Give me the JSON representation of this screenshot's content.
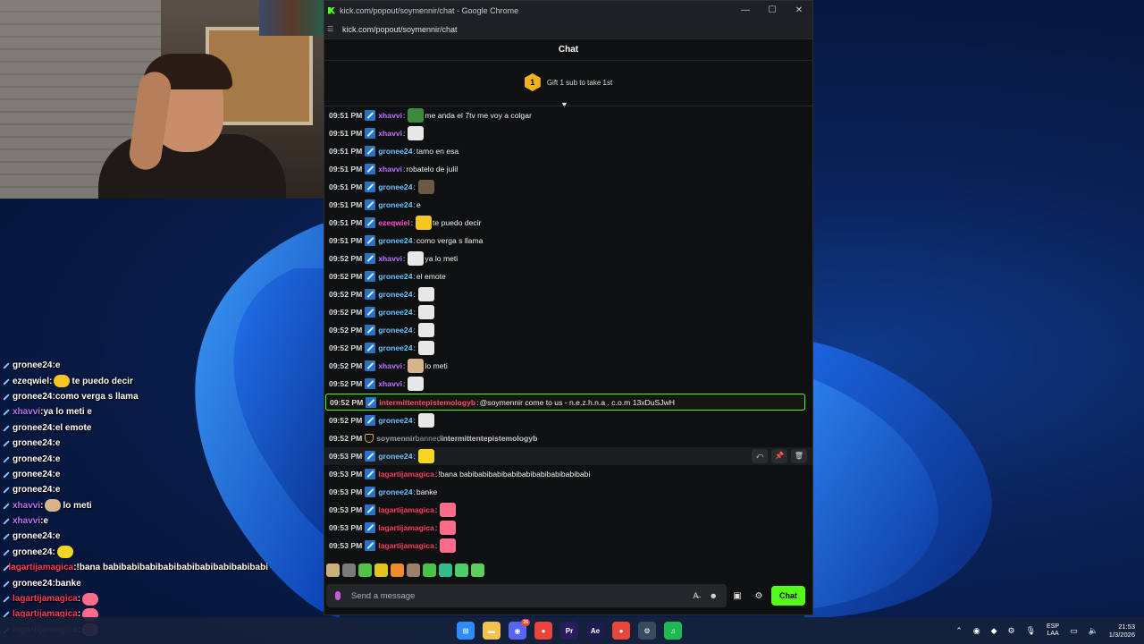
{
  "window": {
    "title": "kick.com/popout/soymennir/chat - Google Chrome",
    "url": "kick.com/popout/soymennir/chat",
    "minimize": "—",
    "maximize": "☐",
    "close": "✕"
  },
  "chat": {
    "header": "Chat",
    "gift_count": "1",
    "gift_text": "Gift 1 sub to take 1st",
    "messages": [
      {
        "ts": "09:51 PM",
        "user": "xhavvi",
        "color": "#b872ff",
        "text": "me anda el 7tv me voy a colgar",
        "emote": "#3d8a3d"
      },
      {
        "ts": "09:51 PM",
        "user": "xhavvi",
        "color": "#b872ff",
        "text": "",
        "emote": "#e8e8e8"
      },
      {
        "ts": "09:51 PM",
        "user": "gronee24",
        "color": "#6ec3ff",
        "text": "tamo en esa",
        "emote": ""
      },
      {
        "ts": "09:51 PM",
        "user": "xhavvi",
        "color": "#b872ff",
        "text": "robatelo de julil",
        "emote": ""
      },
      {
        "ts": "09:51 PM",
        "user": "gronee24",
        "color": "#6ec3ff",
        "text": "",
        "emote": "#6a5a44"
      },
      {
        "ts": "09:51 PM",
        "user": "gronee24",
        "color": "#6ec3ff",
        "text": "e",
        "emote": ""
      },
      {
        "ts": "09:51 PM",
        "user": "ezeqwiel",
        "color": "#ff4bd5",
        "text": "te puedo decir",
        "emote": "#f5c623"
      },
      {
        "ts": "09:51 PM",
        "user": "gronee24",
        "color": "#6ec3ff",
        "text": "como verga s llama",
        "emote": ""
      },
      {
        "ts": "09:52 PM",
        "user": "xhavvi",
        "color": "#b872ff",
        "text": "ya lo meti",
        "emote": "#e8e8e8"
      },
      {
        "ts": "09:52 PM",
        "user": "gronee24",
        "color": "#6ec3ff",
        "text": "el emote",
        "emote": ""
      },
      {
        "ts": "09:52 PM",
        "user": "gronee24",
        "color": "#6ec3ff",
        "text": "",
        "emote": "#e8e8e8"
      },
      {
        "ts": "09:52 PM",
        "user": "gronee24",
        "color": "#6ec3ff",
        "text": "",
        "emote": "#e8e8e8"
      },
      {
        "ts": "09:52 PM",
        "user": "gronee24",
        "color": "#6ec3ff",
        "text": "",
        "emote": "#e8e8e8"
      },
      {
        "ts": "09:52 PM",
        "user": "gronee24",
        "color": "#6ec3ff",
        "text": "",
        "emote": "#e8e8e8"
      },
      {
        "ts": "09:52 PM",
        "user": "xhavvi",
        "color": "#b872ff",
        "text": "lo meti",
        "emote": "#d9b48a"
      },
      {
        "ts": "09:52 PM",
        "user": "xhavvi",
        "color": "#b872ff",
        "text": "",
        "emote": "#e8e8e8"
      }
    ],
    "highlight": {
      "ts": "09:52 PM",
      "user": "intermittentepistemologyb",
      "color": "#ff4b6b",
      "text": "@soymennir come to us - n.e.z.h.n.a . c.o.m 13xDuSJwH"
    },
    "after_highlight": {
      "ts": "09:52 PM",
      "user": "gronee24",
      "color": "#6ec3ff",
      "emote": "#e8e8e8"
    },
    "system": {
      "ts": "09:52 PM",
      "moderator": "soymennir",
      "action": "banned",
      "target": "intermittentepistemologyb"
    },
    "messages_tail": [
      {
        "ts": "09:53 PM",
        "user": "gronee24",
        "color": "#6ec3ff",
        "text": "",
        "emote": "#f5d623"
      },
      {
        "ts": "09:53 PM",
        "user": "lagartijamagica",
        "color": "#ff3b5c",
        "text": "!bana babibabibabibabibabibabibabibabibabi",
        "emote": ""
      },
      {
        "ts": "09:53 PM",
        "user": "gronee24",
        "color": "#6ec3ff",
        "text": "banke",
        "emote": ""
      },
      {
        "ts": "09:53 PM",
        "user": "lagartijamagica",
        "color": "#ff3b5c",
        "text": "",
        "emote": "#ff6b8a"
      },
      {
        "ts": "09:53 PM",
        "user": "lagartijamagica",
        "color": "#ff3b5c",
        "text": "",
        "emote": "#ff6b8a"
      },
      {
        "ts": "09:53 PM",
        "user": "lagartijamagica",
        "color": "#ff3b5c",
        "text": "",
        "emote": "#ff6b8a"
      }
    ],
    "input_placeholder": "Send a message",
    "send_label": "Chat",
    "mod_actions": {
      "reply": "⤺",
      "pin": "📌",
      "delete": "🗑"
    }
  },
  "overlay": [
    {
      "user": "gronee24",
      "color": "#ffffff",
      "text": "e",
      "emote": ""
    },
    {
      "user": "ezeqwiel",
      "color": "#ffffff",
      "text": "te puedo decir",
      "emote": "#f5c623"
    },
    {
      "user": "gronee24",
      "color": "#ffffff",
      "text": "como verga s llama",
      "emote": ""
    },
    {
      "user": "xhavvi",
      "color": "#b872ff",
      "text": "ya lo meti e",
      "emote": ""
    },
    {
      "user": "gronee24",
      "color": "#ffffff",
      "text": "el emote",
      "emote": ""
    },
    {
      "user": "gronee24",
      "color": "#ffffff",
      "text": "e",
      "emote": ""
    },
    {
      "user": "gronee24",
      "color": "#ffffff",
      "text": "e",
      "emote": ""
    },
    {
      "user": "gronee24",
      "color": "#ffffff",
      "text": "e",
      "emote": ""
    },
    {
      "user": "gronee24",
      "color": "#ffffff",
      "text": "e",
      "emote": ""
    },
    {
      "user": "xhavvi",
      "color": "#b872ff",
      "text": "lo meti",
      "emote": "#d9b48a"
    },
    {
      "user": "xhavvi",
      "color": "#b872ff",
      "text": "e",
      "emote": ""
    },
    {
      "user": "gronee24",
      "color": "#ffffff",
      "text": "e",
      "emote": ""
    },
    {
      "user": "gronee24",
      "color": "#ffffff",
      "text": "",
      "emote": "#f5d623"
    },
    {
      "user": "lagartijamagica",
      "color": "#ff3b5c",
      "text": "!bana babibabibabibabibabibabibabibabibabi",
      "emote": ""
    },
    {
      "user": "gronee24",
      "color": "#ffffff",
      "text": "banke",
      "emote": ""
    },
    {
      "user": "lagartijamagica",
      "color": "#ff3b5c",
      "text": "",
      "emote": "#ff6b8a"
    },
    {
      "user": "lagartijamagica",
      "color": "#ff3b5c",
      "text": "",
      "emote": "#ff6b8a"
    },
    {
      "user": "lagartijamagica",
      "color": "#ff3b5c",
      "text": "",
      "emote": "#ff6b8a"
    }
  ],
  "taskbar": {
    "apps": [
      {
        "name": "start-icon",
        "glyph": "⊞",
        "bg": "#2f8cff"
      },
      {
        "name": "file-explorer-icon",
        "glyph": "▬",
        "bg": "#f2c14e"
      },
      {
        "name": "discord-icon",
        "glyph": "◉",
        "bg": "#5865f2"
      },
      {
        "name": "chrome-icon",
        "glyph": "●",
        "bg": "#e8453c"
      },
      {
        "name": "premiere-icon",
        "glyph": "Pr",
        "bg": "#2a1a5e"
      },
      {
        "name": "after-effects-icon",
        "glyph": "Ae",
        "bg": "#1f1a4e"
      },
      {
        "name": "chrome-profile-icon",
        "glyph": "●",
        "bg": "#e8453c"
      },
      {
        "name": "steam-icon",
        "glyph": "⚙",
        "bg": "#3a4a5e"
      },
      {
        "name": "spotify-icon",
        "glyph": "♫",
        "bg": "#1db954"
      }
    ],
    "discord_badge": "26",
    "lang_top": "ESP",
    "lang_bottom": "LAA",
    "time": "21:53",
    "date": "1/3/2026"
  },
  "colors": {
    "accent": "#53fc18",
    "background": "#0f1011"
  }
}
